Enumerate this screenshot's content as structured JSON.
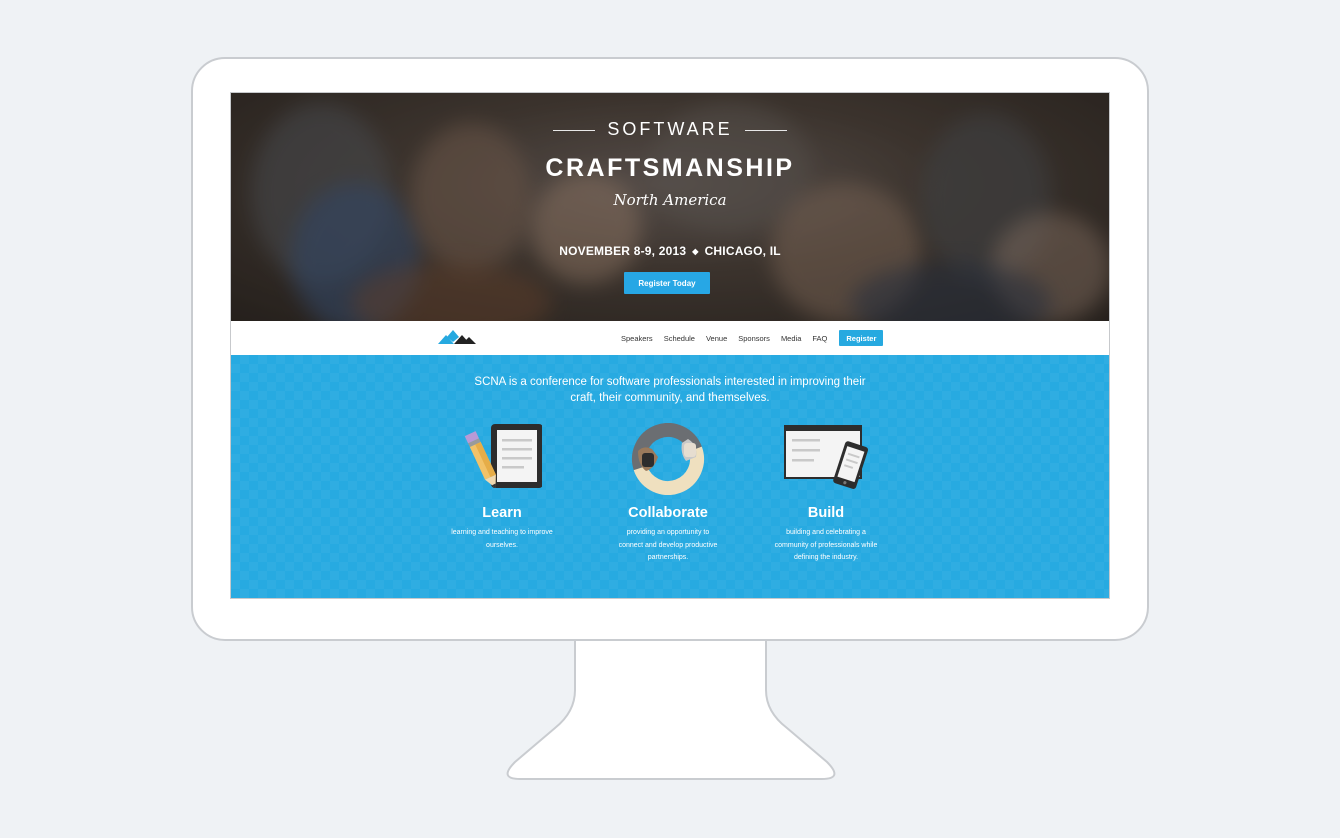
{
  "hero": {
    "software": "SOFTWARE",
    "title": "CRAFTSMANSHIP",
    "subtitle": "North America",
    "date": "NOVEMBER 8-9, 2013",
    "location": "CHICAGO, IL",
    "cta_label": "Register Today"
  },
  "nav": {
    "links": [
      "Speakers",
      "Schedule",
      "Venue",
      "Sponsors",
      "Media",
      "FAQ"
    ],
    "register_label": "Register"
  },
  "intro": {
    "line1": "SCNA is a conference for software professionals interested in improving their",
    "line2": "craft, their community, and themselves."
  },
  "features": [
    {
      "title": "Learn",
      "desc_line1": "learning and teaching to improve",
      "desc_line2": "ourselves.",
      "desc_line3": "",
      "icon": "tablet-pencil-icon"
    },
    {
      "title": "Collaborate",
      "desc_line1": "providing an opportunity to",
      "desc_line2": "connect and develop productive",
      "desc_line3": "partnerships.",
      "icon": "handshake-icon"
    },
    {
      "title": "Build",
      "desc_line1": "building and celebrating a",
      "desc_line2": "community of professionals while",
      "desc_line3": "defining the industry.",
      "icon": "browser-phone-icon"
    }
  ],
  "colors": {
    "accent": "#26a9e0",
    "page_background": "#eff2f5",
    "monitor_frame": "#ffffff"
  }
}
